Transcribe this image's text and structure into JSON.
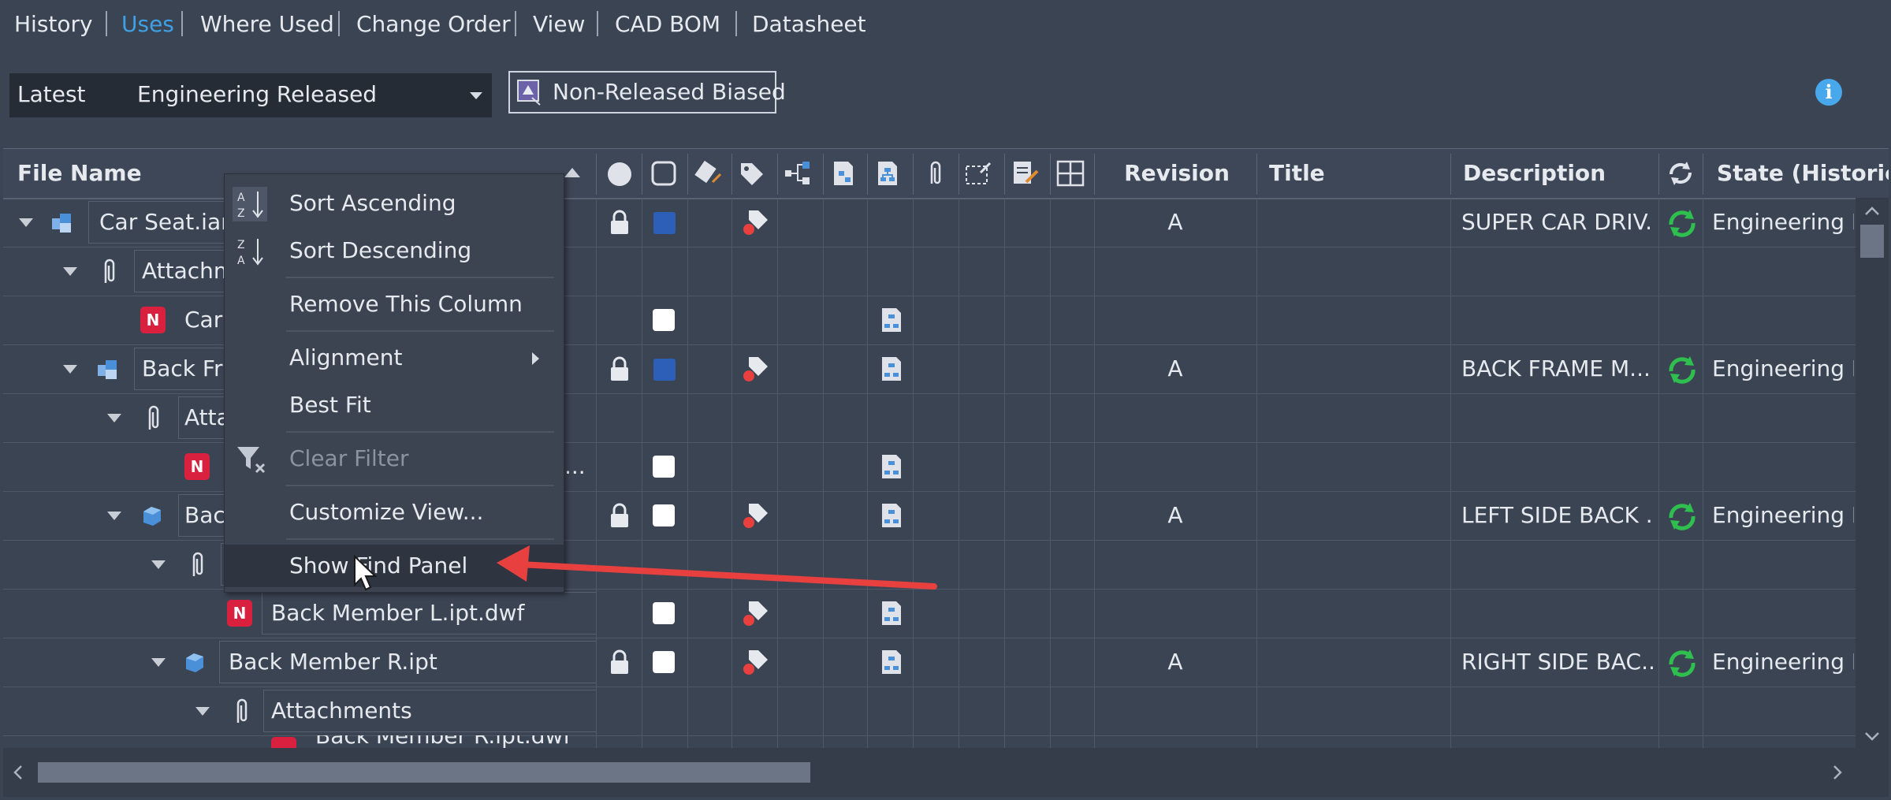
{
  "tabs": [
    {
      "label": "History",
      "active": false
    },
    {
      "label": "Uses",
      "active": true
    },
    {
      "label": "Where Used",
      "active": false
    },
    {
      "label": "Change Order",
      "active": false
    },
    {
      "label": "View",
      "active": false
    },
    {
      "label": "CAD BOM",
      "active": false
    },
    {
      "label": "Datasheet",
      "active": false
    }
  ],
  "version_filter": {
    "version": "Latest",
    "status": "Engineering Released"
  },
  "bias_button": {
    "label": "Non-Released Biased"
  },
  "columns": {
    "file_name": "File Name",
    "revision": "Revision",
    "title": "Title",
    "description": "Description",
    "state": "State (Historica"
  },
  "rows": [
    {
      "name": "Car Seat.iam",
      "revision": "A",
      "description": "SUPER CAR DRIV...",
      "state": "Engineering R"
    },
    {
      "name": "Attachments"
    },
    {
      "name": "Car"
    },
    {
      "name": "Back Fra",
      "revision": "A",
      "description": "BACK FRAME M...",
      "state": "Engineering R"
    },
    {
      "name": "Atta"
    },
    {
      "name": "..."
    },
    {
      "name": "Bac",
      "revision": "A",
      "description": "LEFT SIDE BACK ...",
      "state": "Engineering R"
    },
    {
      "name": ""
    },
    {
      "name": "Back Member L.ipt.dwf"
    },
    {
      "name": "Back Member R.ipt",
      "revision": "A",
      "description": "RIGHT SIDE BAC...",
      "state": "Engineering R"
    },
    {
      "name": "Attachments"
    },
    {
      "name": "Back Member R.ipt.dwf"
    }
  ],
  "context_menu": {
    "sort_ascending": "Sort Ascending",
    "sort_descending": "Sort Descending",
    "remove_column": "Remove This Column",
    "alignment": "Alignment",
    "best_fit": "Best Fit",
    "clear_filter": "Clear Filter",
    "customize_view": "Customize View...",
    "show_find_panel": "Show Find Panel"
  },
  "colors": {
    "background": "#3b4453",
    "active_tab": "#3ea1e6",
    "annotation_arrow": "#e8403f",
    "state_icon": "#2fbf4f",
    "lock_blue": "#2d5fb8"
  }
}
